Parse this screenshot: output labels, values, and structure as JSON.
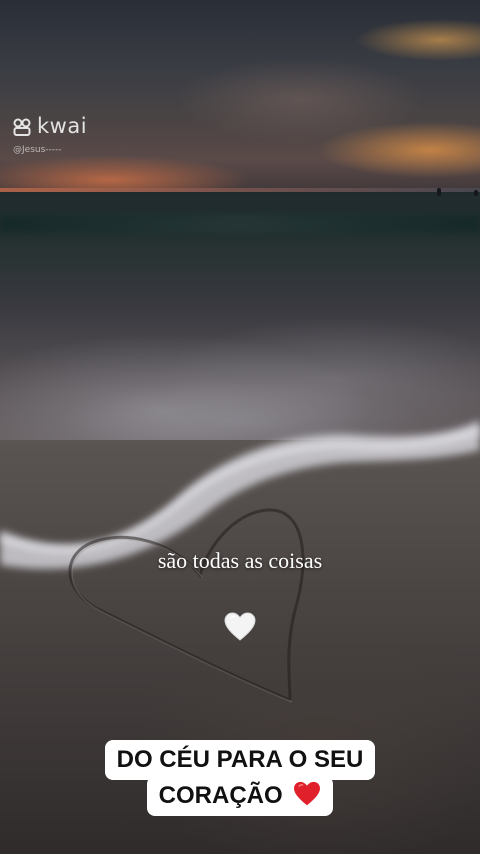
{
  "app": {
    "brand_name": "kwai",
    "logo_icon": "kwai-logo-icon",
    "handle": "@Jesus-----"
  },
  "video": {
    "scene": "beach-sunset-heart-in-sand",
    "caption": "são todas as coisas",
    "caption_icon": "white-heart-icon"
  },
  "banner": {
    "line1": "DO CÉU PARA O SEU",
    "line2": "CORAÇÃO",
    "line2_icon": "red-heart-icon"
  },
  "colors": {
    "banner_bg": "#ffffff",
    "banner_text": "#111111",
    "caption_text": "#ffffff",
    "red_heart": "#e0202a"
  }
}
